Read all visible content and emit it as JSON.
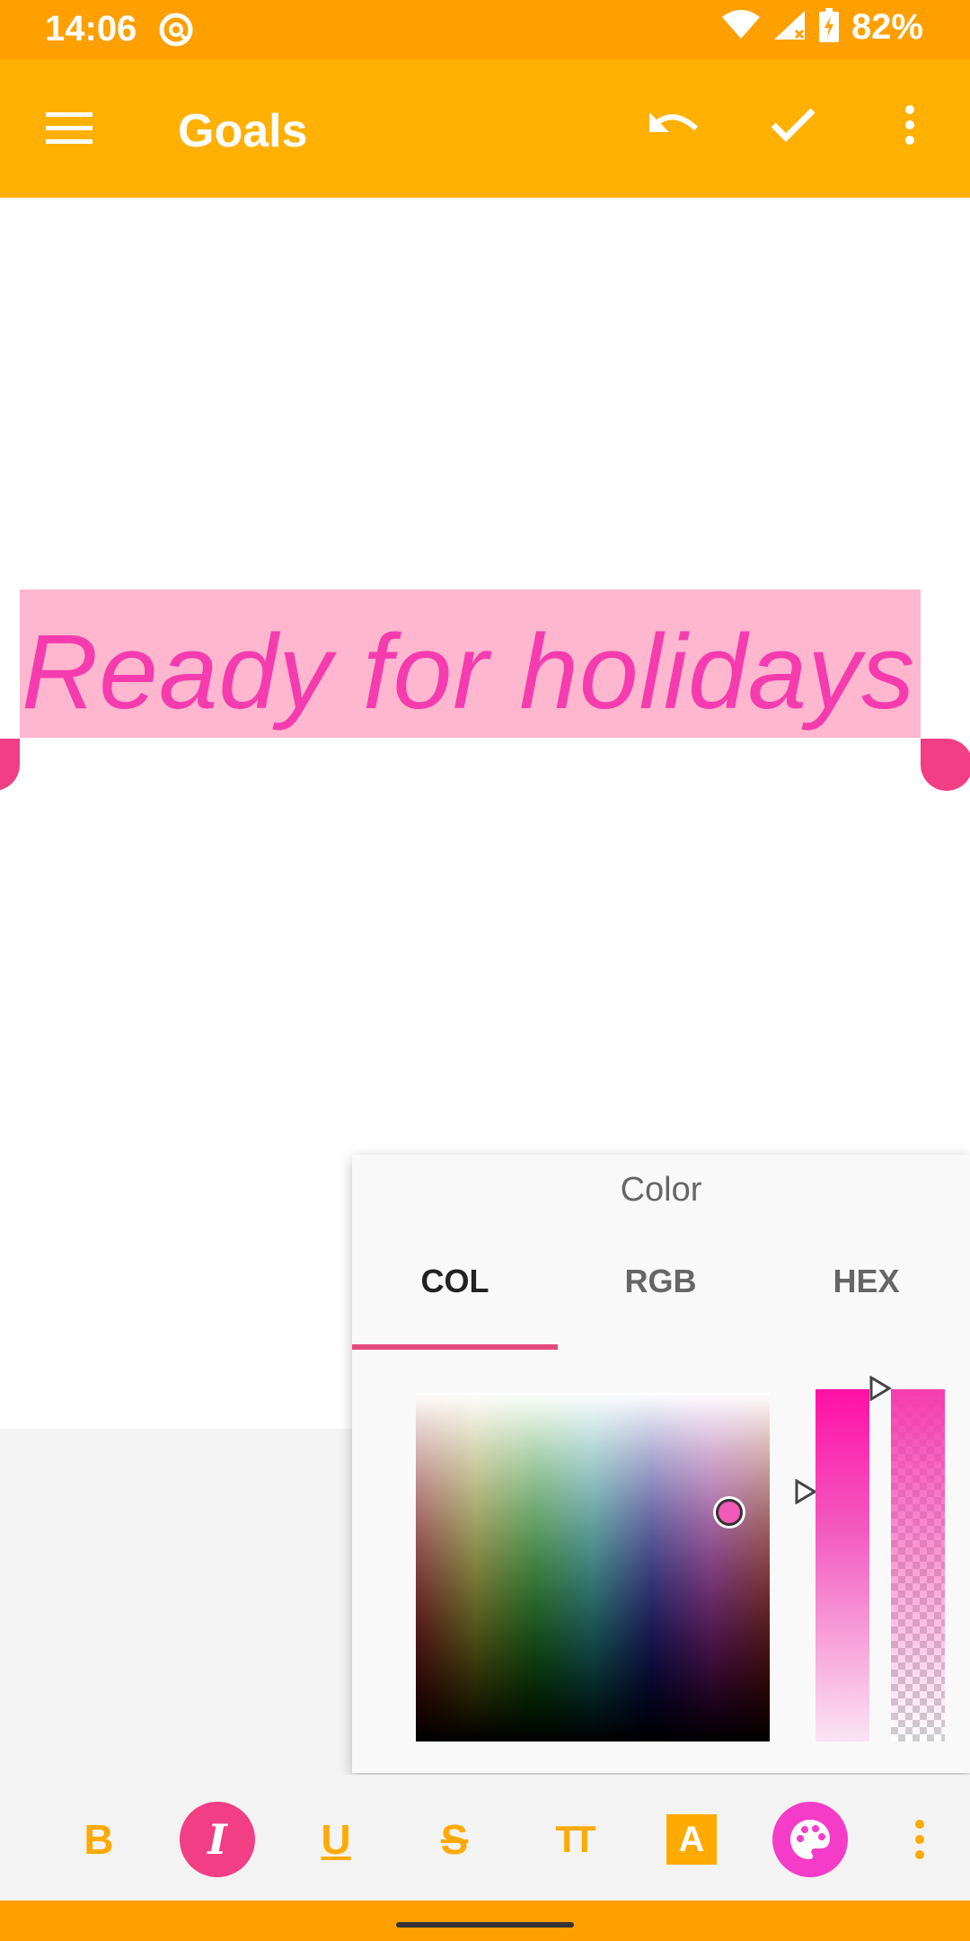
{
  "status_bar": {
    "time": "14:06",
    "battery": "82%"
  },
  "app_bar": {
    "title": "Goals"
  },
  "editor": {
    "selected_text": "Ready for holidays"
  },
  "color_picker": {
    "title": "Color",
    "tabs": [
      "COL",
      "RGB",
      "HEX"
    ],
    "active_tab": "COL",
    "selected_color": "#F53CAF"
  },
  "format_bar": {
    "bold_label": "B",
    "italic_label": "I",
    "underline_label": "U",
    "strike_label": "S",
    "size_label": "TT",
    "text_color_label": "A"
  },
  "colors": {
    "status_bar": "#FF9F00",
    "app_bar": "#FFB000",
    "accent": "#F13E84",
    "highlight": "#FFB6CF",
    "text_pink": "#F53CAF"
  }
}
